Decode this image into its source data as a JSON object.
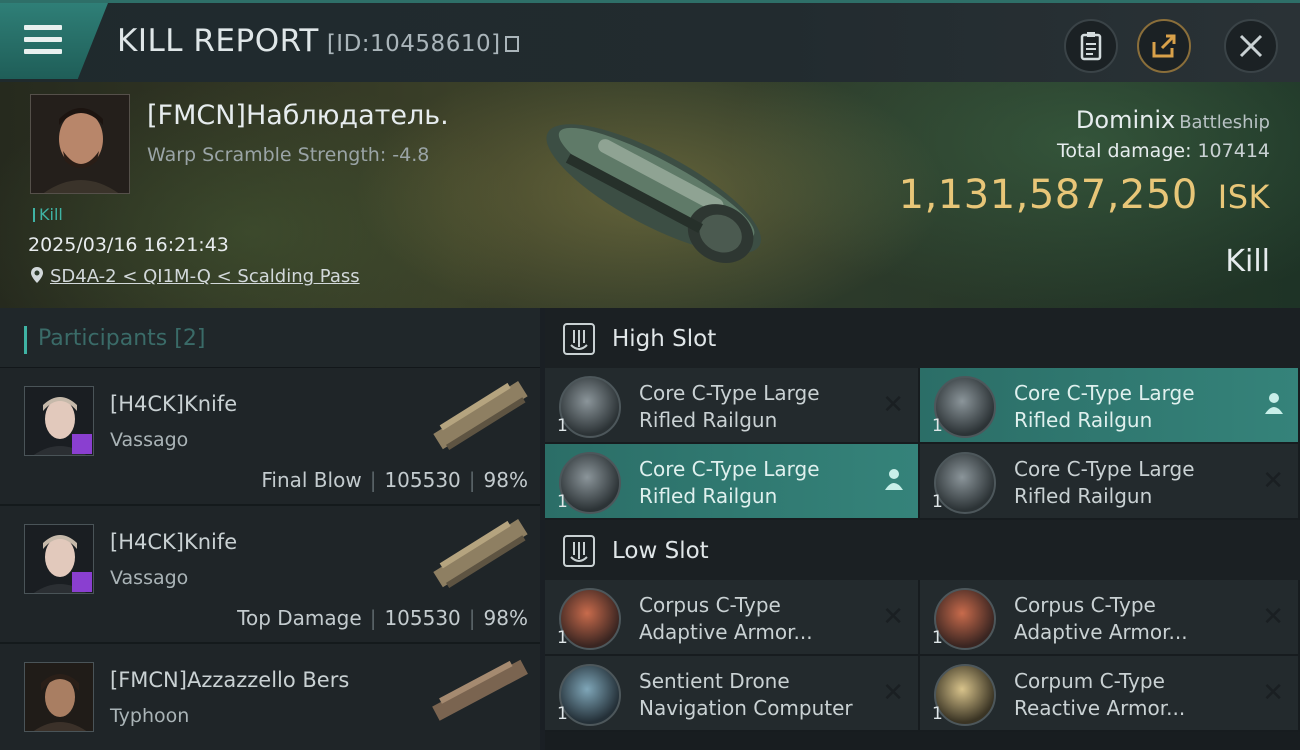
{
  "header": {
    "title": "KILL REPORT",
    "id_label": "[ID:10458610]"
  },
  "victim": {
    "name": "[FMCN]Наблюдатель.",
    "warp_scramble": "Warp Scramble Strength: -4.8",
    "tag": "Kill",
    "datetime": "2025/03/16 16:21:43",
    "location": "SD4A-2 < QI1M-Q < Scalding Pass",
    "ship": "Dominix",
    "ship_class": "Battleship",
    "total_damage_label": "Total damage:",
    "total_damage": "107414",
    "isk_value": "1,131,587,250",
    "isk_unit": "ISK",
    "result": "Kill"
  },
  "participants": {
    "label": "Participants",
    "count": "[2]",
    "rows": [
      {
        "name": "[H4CK]Knife",
        "ship": "Vassago",
        "role": "Final Blow",
        "damage": "105530",
        "percent": "98%"
      },
      {
        "name": "[H4CK]Knife",
        "ship": "Vassago",
        "role": "Top Damage",
        "damage": "105530",
        "percent": "98%"
      },
      {
        "name": "[FMCN]Azzazzello Bers",
        "ship": "Typhoon",
        "role": "",
        "damage": "",
        "percent": ""
      }
    ]
  },
  "high_slot": {
    "label": "High Slot",
    "modules": [
      {
        "name": "Core C-Type Large Rifled Railgun",
        "qty": "1",
        "active": false,
        "marker": "✕"
      },
      {
        "name": "Core C-Type Large Rifled Railgun",
        "qty": "1",
        "active": true,
        "marker": "person"
      },
      {
        "name": "Core C-Type Large Rifled Railgun",
        "qty": "1",
        "active": true,
        "marker": "person"
      },
      {
        "name": "Core C-Type Large Rifled Railgun",
        "qty": "1",
        "active": false,
        "marker": "✕"
      }
    ]
  },
  "low_slot": {
    "label": "Low Slot",
    "modules": [
      {
        "name": "Corpus C-Type Adaptive Armor...",
        "qty": "1",
        "marker": "✕"
      },
      {
        "name": "Corpus C-Type Adaptive Armor...",
        "qty": "1",
        "marker": "✕"
      },
      {
        "name": "Sentient Drone Navigation Computer",
        "qty": "1",
        "marker": "✕"
      },
      {
        "name": "Corpum C-Type Reactive Armor...",
        "qty": "1",
        "marker": "✕"
      }
    ]
  },
  "icons": [
    "menu-icon",
    "copy-icon",
    "clipboard-icon",
    "share-icon",
    "close-icon",
    "location-pin-icon",
    "slot-icon",
    "person-icon"
  ]
}
